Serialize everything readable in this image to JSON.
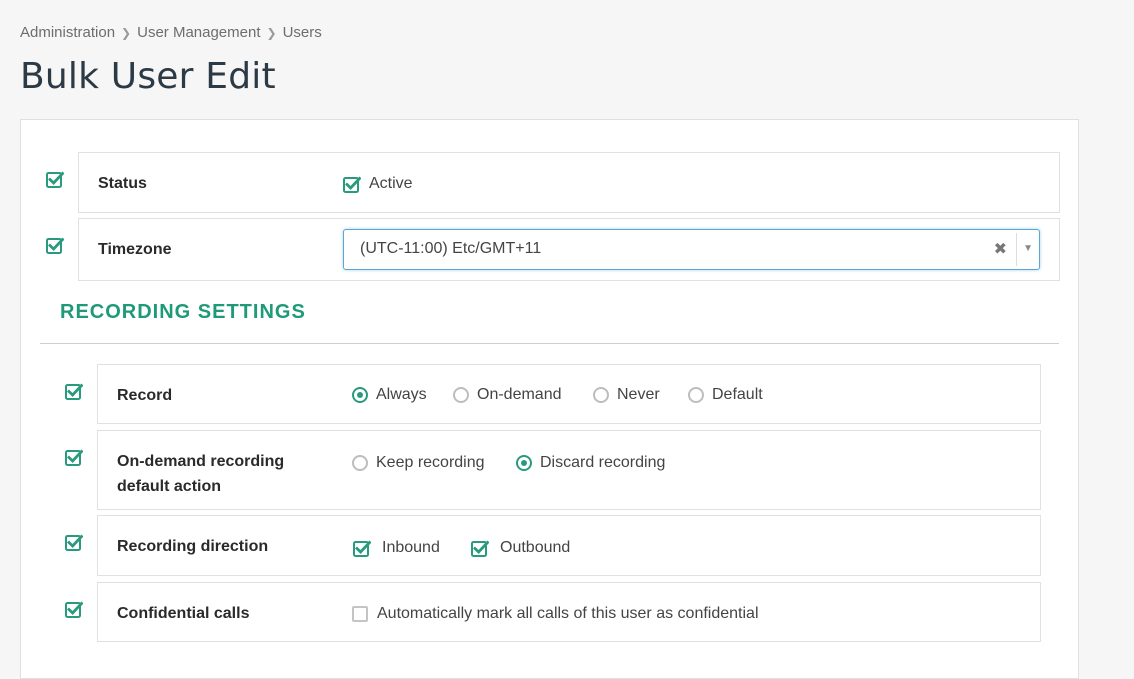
{
  "breadcrumb": {
    "items": [
      "Administration",
      "User Management",
      "Users"
    ]
  },
  "page": {
    "title": "Bulk User Edit"
  },
  "general": {
    "status": {
      "label": "Status",
      "option_label": "Active",
      "checked": true
    },
    "timezone": {
      "label": "Timezone",
      "value": "(UTC-11:00) Etc/GMT+11"
    }
  },
  "recording": {
    "heading": "RECORDING SETTINGS",
    "record": {
      "label": "Record",
      "options": [
        "Always",
        "On-demand",
        "Never",
        "Default"
      ],
      "selected": "Always"
    },
    "ondemand": {
      "label_line1": "On-demand recording",
      "label_line2": "default action",
      "options": [
        "Keep recording",
        "Discard recording"
      ],
      "selected": "Discard recording"
    },
    "direction": {
      "label": "Recording direction",
      "options": [
        "Inbound",
        "Outbound"
      ],
      "checked": [
        "Inbound",
        "Outbound"
      ]
    },
    "confidential": {
      "label": "Confidential calls",
      "option_label": "Automatically mark all calls of this user as confidential",
      "checked": false
    }
  },
  "colors": {
    "accent": "#1f9a78",
    "title": "#2c3a45",
    "focus_border": "#58a6d6"
  }
}
